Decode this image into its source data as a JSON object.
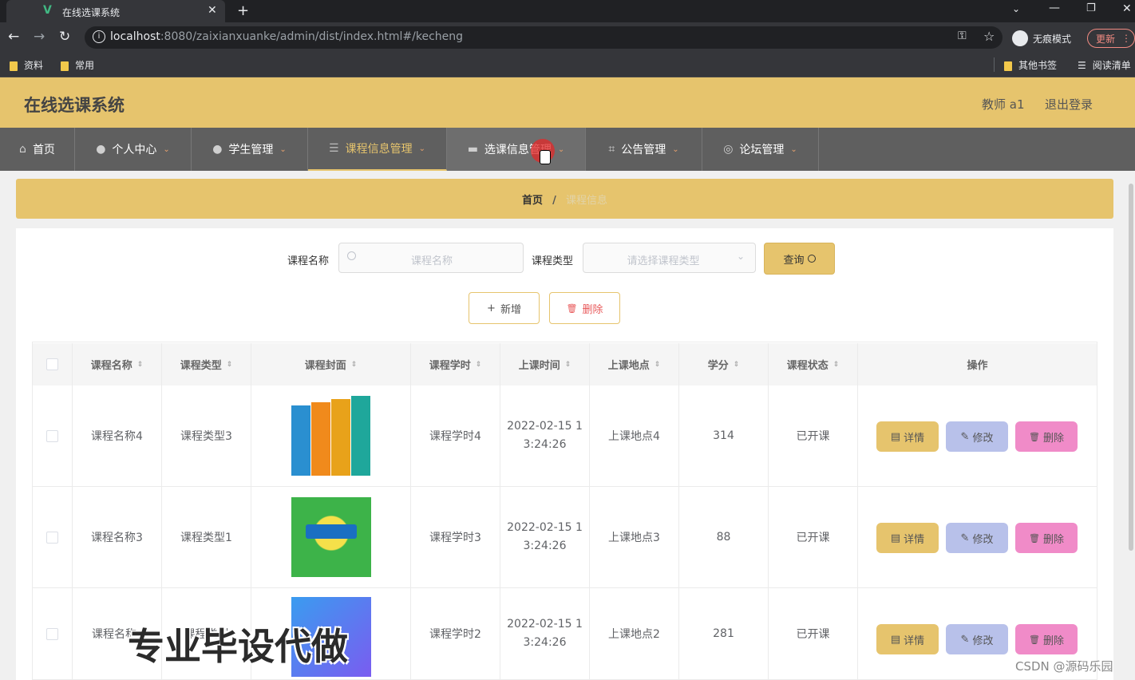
{
  "browser": {
    "tab_title": "在线选课系统",
    "url_host": "localhost",
    "url_rest": ":8080/zaixianxuanke/admin/dist/index.html#/kecheng",
    "incognito_label": "无痕模式",
    "update_label": "更新",
    "bookmarks": [
      "资料",
      "常用"
    ],
    "other_bookmarks": "其他书签",
    "reading_list": "阅读清单"
  },
  "header": {
    "title": "在线选课系统",
    "user": "教师 a1",
    "logout": "退出登录"
  },
  "nav": {
    "items": [
      {
        "label": "首页",
        "icon": "home-icon"
      },
      {
        "label": "个人中心",
        "icon": "user-icon"
      },
      {
        "label": "学生管理",
        "icon": "user-icon"
      },
      {
        "label": "课程信息管理",
        "icon": "list-icon"
      },
      {
        "label": "选课信息管理",
        "icon": "chat-icon"
      },
      {
        "label": "公告管理",
        "icon": "crop-icon"
      },
      {
        "label": "论坛管理",
        "icon": "compass-icon"
      }
    ]
  },
  "breadcrumb": {
    "home": "首页",
    "sep": "/",
    "current": "课程信息"
  },
  "search": {
    "name_label": "课程名称",
    "name_placeholder": "课程名称",
    "type_label": "课程类型",
    "type_placeholder": "请选择课程类型",
    "query_button": "查询"
  },
  "actions": {
    "add": "新增",
    "delete": "删除"
  },
  "table": {
    "headers": [
      "课程名称",
      "课程类型",
      "课程封面",
      "课程学时",
      "上课时间",
      "上课地点",
      "学分",
      "课程状态",
      "操作"
    ],
    "rows": [
      {
        "name": "课程名称4",
        "type": "课程类型3",
        "hours": "课程学时4",
        "time1": "2022-02-15 1",
        "time2": "3:24:26",
        "place": "上课地点4",
        "credit": "314",
        "status": "已开课"
      },
      {
        "name": "课程名称3",
        "type": "课程类型1",
        "hours": "课程学时3",
        "time1": "2022-02-15 1",
        "time2": "3:24:26",
        "place": "上课地点3",
        "credit": "88",
        "status": "已开课"
      },
      {
        "name": "课程名称",
        "type": "课程类型",
        "hours": "课程学时2",
        "time1": "2022-02-15 1",
        "time2": "3:24:26",
        "place": "上课地点2",
        "credit": "281",
        "status": "已开课"
      }
    ],
    "row_actions": {
      "detail": "详情",
      "edit": "修改",
      "delete": "删除"
    }
  },
  "overlay": {
    "watermark": "专业毕设代做",
    "csdn": "CSDN @源码乐园"
  }
}
